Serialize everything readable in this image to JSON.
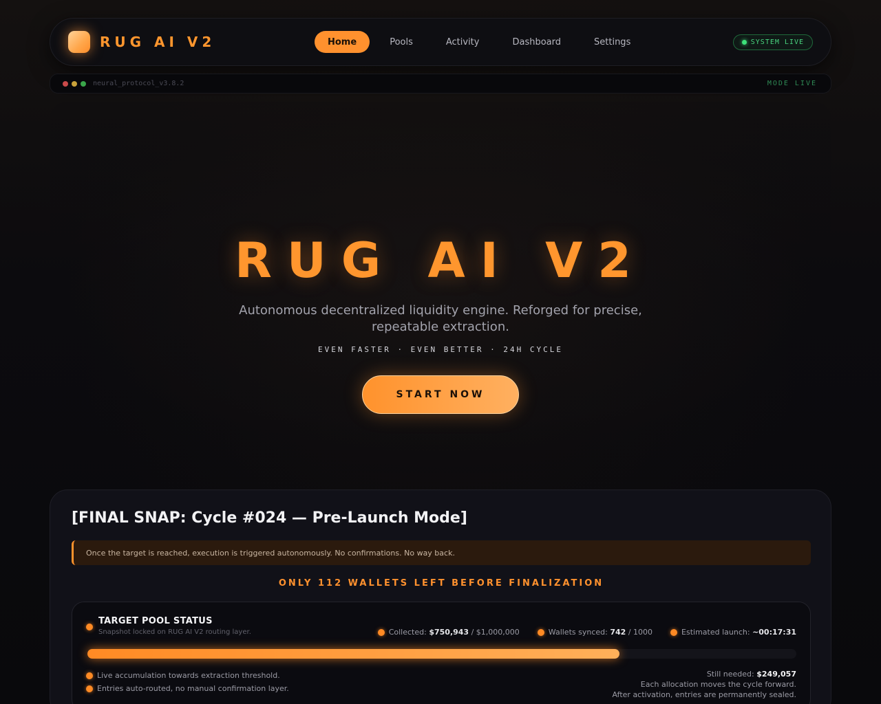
{
  "nav": {
    "brand": "RUG AI V2",
    "links": [
      "Home",
      "Pools",
      "Activity",
      "Dashboard",
      "Settings"
    ],
    "active": "Home",
    "status": "SYSTEM LIVE"
  },
  "terminal": {
    "name": "neural_protocol_v3.8.2",
    "mode": "MODE LIVE",
    "dot_colors": [
      "#c94a4a",
      "#c9a23a",
      "#3aa64a"
    ]
  },
  "hero": {
    "title": "RUG AI V2",
    "subtitle": "Autonomous decentralized liquidity engine. Reforged for precise, repeatable extraction.",
    "tagline": "EVEN FASTER · EVEN BETTER · 24H CYCLE",
    "cta": "START NOW"
  },
  "snap": {
    "title": "[FINAL SNAP: Cycle #024 — Pre-Launch Mode]",
    "alert": "Once the target is reached, execution is triggered autonomously. No confirmations. No way back.",
    "wallets_left": "ONLY 112 WALLETS LEFT BEFORE FINALIZATION",
    "pool": {
      "title": "TARGET POOL STATUS",
      "subtitle": "Snapshot locked on RUG AI V2 routing layer.",
      "collected_label": "Collected:",
      "collected": "$750,943",
      "collected_target": "/ $1,000,000",
      "wallets_label": "Wallets synced:",
      "wallets": "742",
      "wallets_total": "/ 1000",
      "launch_label": "Estimated launch:",
      "launch": "~00:17:31",
      "progress": 0.75,
      "notes": [
        "Live accumulation towards extraction threshold.",
        "Entries auto-routed, no manual confirmation layer."
      ],
      "still_needed_label": "Still needed:",
      "still_needed": "$249,057",
      "right_notes": [
        "Each allocation moves the cycle forward.",
        "After activation, entries are permanently sealed."
      ]
    }
  },
  "colors": {
    "accent": "#ff922c",
    "live": "#3ee07a"
  }
}
